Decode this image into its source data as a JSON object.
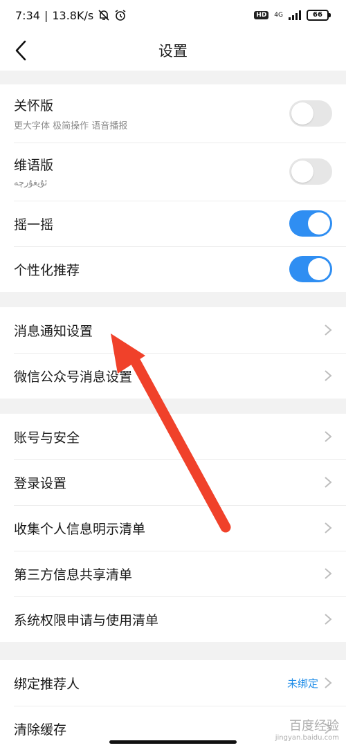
{
  "status_bar": {
    "time": "7:34",
    "net_speed": "13.8K/s",
    "network_badge": "HD",
    "network_type": "4G",
    "battery": "66",
    "icons": [
      "mute-icon",
      "alarm-icon",
      "signal-icon",
      "battery-icon"
    ]
  },
  "header": {
    "title": "设置",
    "back_icon": "chevron-left-icon"
  },
  "groups": [
    {
      "items": [
        {
          "label": "关怀版",
          "subtitle": "更大字体 极简操作 语音播报",
          "control": "toggle",
          "on": false
        },
        {
          "label": "维语版",
          "subtitle": "ئۇيغۇرچە",
          "control": "toggle",
          "on": false
        },
        {
          "label": "摇一摇",
          "control": "toggle",
          "on": true
        },
        {
          "label": "个性化推荐",
          "control": "toggle",
          "on": true
        }
      ]
    },
    {
      "items": [
        {
          "label": "消息通知设置",
          "control": "chevron"
        },
        {
          "label": "微信公众号消息设置",
          "control": "chevron"
        }
      ]
    },
    {
      "items": [
        {
          "label": "账号与安全",
          "control": "chevron"
        },
        {
          "label": "登录设置",
          "control": "chevron"
        },
        {
          "label": "收集个人信息明示清单",
          "control": "chevron"
        },
        {
          "label": "第三方信息共享清单",
          "control": "chevron"
        },
        {
          "label": "系统权限申请与使用清单",
          "control": "chevron"
        }
      ]
    },
    {
      "items": [
        {
          "label": "绑定推荐人",
          "value": "未绑定",
          "control": "chevron"
        },
        {
          "label": "清除缓存",
          "value": "",
          "control": "chevron"
        }
      ]
    }
  ],
  "colors": {
    "toggle_on": "#2f8ef2",
    "toggle_off": "#e6e6e6",
    "link_value": "#1e8ce8",
    "annotation_arrow": "#f0412a",
    "page_background": "#f2f2f2"
  },
  "annotation": {
    "type": "arrow",
    "target": "消息通知设置",
    "color": "#f0412a"
  },
  "watermark": {
    "text": "百度经验",
    "url": "jingyan.baidu.com"
  }
}
